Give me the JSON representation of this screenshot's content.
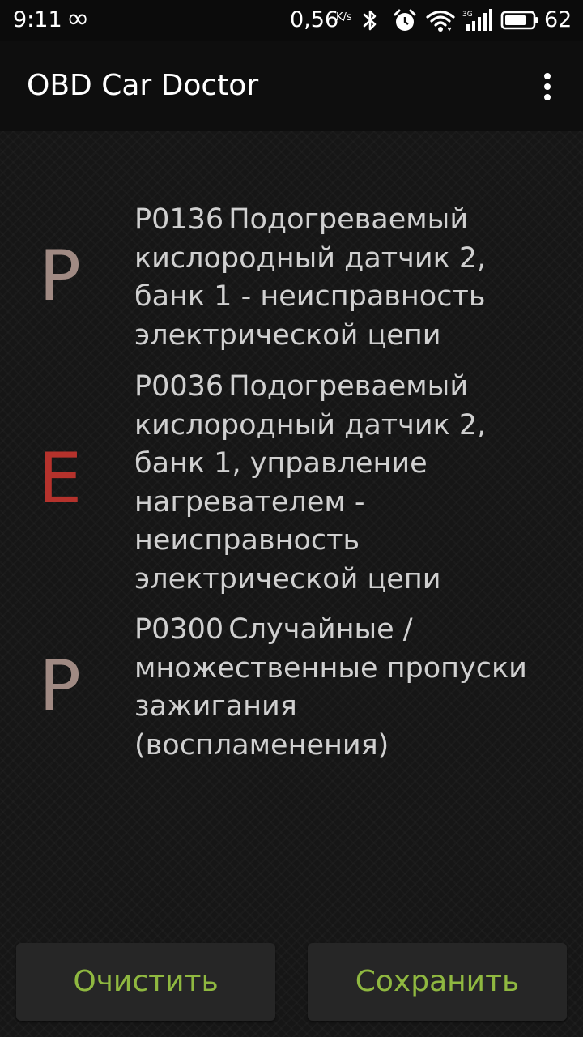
{
  "status_bar": {
    "time": "9:11",
    "infinity_glyph": "∞",
    "network_speed": "0,56",
    "network_speed_unit": "K/s",
    "network_type": "3G",
    "battery_percent": "62",
    "icons": [
      "infinity-icon",
      "bluetooth-icon",
      "alarm-icon",
      "wifi-icon",
      "cellular-signal-icon",
      "battery-icon"
    ]
  },
  "app_bar": {
    "title": "OBD Car Doctor",
    "menu_icon": "more-vert-icon"
  },
  "colors": {
    "pending_letter": "#a08a83",
    "error_letter": "#b5322c",
    "button_text": "#8fb840",
    "text": "#d0d0d0"
  },
  "dtc_list": [
    {
      "letter": "P",
      "status_color": "#a08a83",
      "code": "P0136",
      "lines": [
        "Подогреваемый",
        "кислородный датчик 2,",
        "банк 1 - неисправность",
        "электрической цепи"
      ]
    },
    {
      "letter": "E",
      "status_color": "#b5322c",
      "code": "P0036",
      "lines": [
        "Подогреваемый",
        "кислородный датчик 2,",
        "банк 1, управление",
        "нагревателем -",
        "неисправность",
        "электрической цепи"
      ]
    },
    {
      "letter": "P",
      "status_color": "#a08a83",
      "code": "P0300",
      "lines": [
        "Случайные /",
        "множественные пропуски",
        "зажигания",
        "(воспламенения)"
      ]
    }
  ],
  "buttons": {
    "clear_label": "Очистить",
    "save_label": "Сохранить"
  }
}
